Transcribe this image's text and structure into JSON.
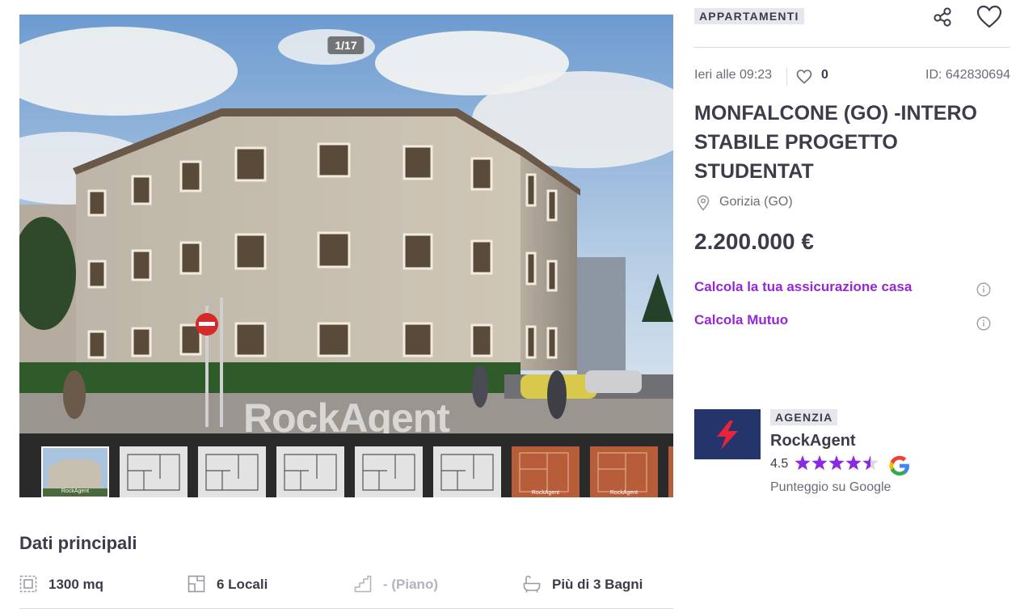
{
  "gallery": {
    "counter": "1/17",
    "watermark": "RockAgent",
    "thumbnails": [
      {
        "type": "photo",
        "caption": "RockAgent",
        "selected": true
      },
      {
        "type": "plan",
        "caption": "",
        "selected": false
      },
      {
        "type": "plan",
        "caption": "",
        "selected": false
      },
      {
        "type": "plan",
        "caption": "",
        "selected": false
      },
      {
        "type": "plan",
        "caption": "",
        "selected": false
      },
      {
        "type": "plan",
        "caption": "",
        "selected": false
      },
      {
        "type": "brick",
        "caption": "RockAgent",
        "selected": false
      },
      {
        "type": "brick",
        "caption": "RockAgent",
        "selected": false
      },
      {
        "type": "brick",
        "caption": "",
        "selected": false
      }
    ]
  },
  "listing": {
    "category": "APPARTAMENTI",
    "date": "Ieri alle 09:23",
    "likes": "0",
    "id": "ID: 642830694",
    "title": "MONFALCONE (GO) -INTERO STABILE PROGETTO STUDENTAT",
    "location": "Gorizia (GO)",
    "price": "2.200.000 €",
    "insurance_link": "Calcola la tua assicurazione casa",
    "mortgage_link": "Calcola Mutuo"
  },
  "icons": {
    "share": "share-icon",
    "favorite": "heart-icon",
    "location": "map-pin-icon",
    "info": "info-icon",
    "google": "google-icon"
  },
  "agency": {
    "badge": "AGENZIA",
    "name": "RockAgent",
    "rating": "4.5",
    "rating_value": 4.5,
    "rating_max": 5,
    "rating_source": "Punteggio su Google"
  },
  "main_data": {
    "title": "Dati principali",
    "features": [
      {
        "icon": "surface-icon",
        "label": "1300 mq"
      },
      {
        "icon": "rooms-icon",
        "label": "6 Locali"
      },
      {
        "icon": "stairs-icon",
        "label": "- (Piano)"
      },
      {
        "icon": "bathtub-icon",
        "label": "Più di 3 Bagni"
      }
    ]
  },
  "colors": {
    "accent": "#9727d4",
    "text": "#3c3c4a",
    "muted": "#6b6b78",
    "badge_bg": "#e6e6ee",
    "star": "#8a2be2",
    "agency_logo_bg": "#24356b",
    "agency_logo_mark": "#e8243c"
  }
}
